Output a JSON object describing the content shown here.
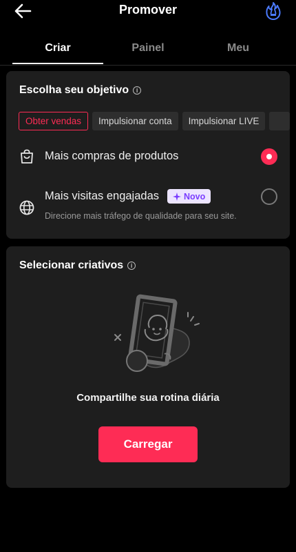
{
  "header": {
    "title": "Promover",
    "back_icon": "arrow-left-icon",
    "flame_icon": "flame-icon"
  },
  "tabs": [
    {
      "label": "Criar",
      "active": true
    },
    {
      "label": "Painel",
      "active": false
    },
    {
      "label": "Meu",
      "active": false
    }
  ],
  "objective": {
    "title": "Escolha seu objetivo",
    "chips": [
      {
        "label": "Obter vendas",
        "selected": true
      },
      {
        "label": "Impulsionar conta",
        "selected": false
      },
      {
        "label": "Impulsionar LIVE",
        "selected": false
      }
    ],
    "options": [
      {
        "icon": "shopping-bag-icon",
        "label": "Mais compras de produtos",
        "checked": true
      },
      {
        "icon": "globe-icon",
        "label": "Mais visitas engajadas",
        "badge": "Novo",
        "description": "Direcione mais tráfego de qualidade para seu site.",
        "checked": false
      }
    ]
  },
  "creative": {
    "title": "Selecionar criativos",
    "share_text": "Compartilhe sua rotina diária",
    "upload_label": "Carregar"
  },
  "colors": {
    "accent": "#fe2c55",
    "card": "#1e1e1e",
    "background": "#000000",
    "badge_bg": "#ece4ff",
    "badge_text": "#7a3cff"
  }
}
